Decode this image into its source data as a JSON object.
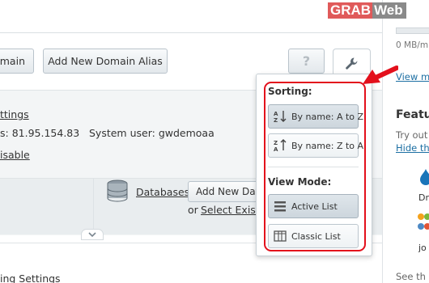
{
  "watermark": {
    "part1": "GRAB",
    "part2": "Web"
  },
  "toolbar": {
    "domain_label": "omain",
    "alias_label": "Add New Domain Alias",
    "help_label": "?"
  },
  "panel": {
    "settings_link": "ttings",
    "ip_line": "s: 81.95.154.83",
    "system_user": "System user: gwdemoaa",
    "disable_link": "isable",
    "databases_link": "Databases",
    "add_db_label": "Add New Data",
    "or_label": "or",
    "select_existing_link": "Select Existi"
  },
  "lower": {
    "settings_link": "ing Settings"
  },
  "sidebar": {
    "usage": "0 MB/m",
    "view_link": "View m",
    "feature_title": "Featu",
    "try_text": "Try out",
    "hide_link": "Hide th",
    "dr_label": "Dr",
    "jo_label": "jo",
    "see_text": "See th"
  },
  "dropdown": {
    "sorting_label": "Sorting:",
    "sort_az": "By name: A to Z",
    "sort_za": "By name: Z to A",
    "view_mode_label": "View Mode:",
    "active_list": "Active List",
    "classic_list": "Classic List"
  },
  "colors": {
    "highlight": "#e3101c",
    "link": "#1c6fa3"
  }
}
